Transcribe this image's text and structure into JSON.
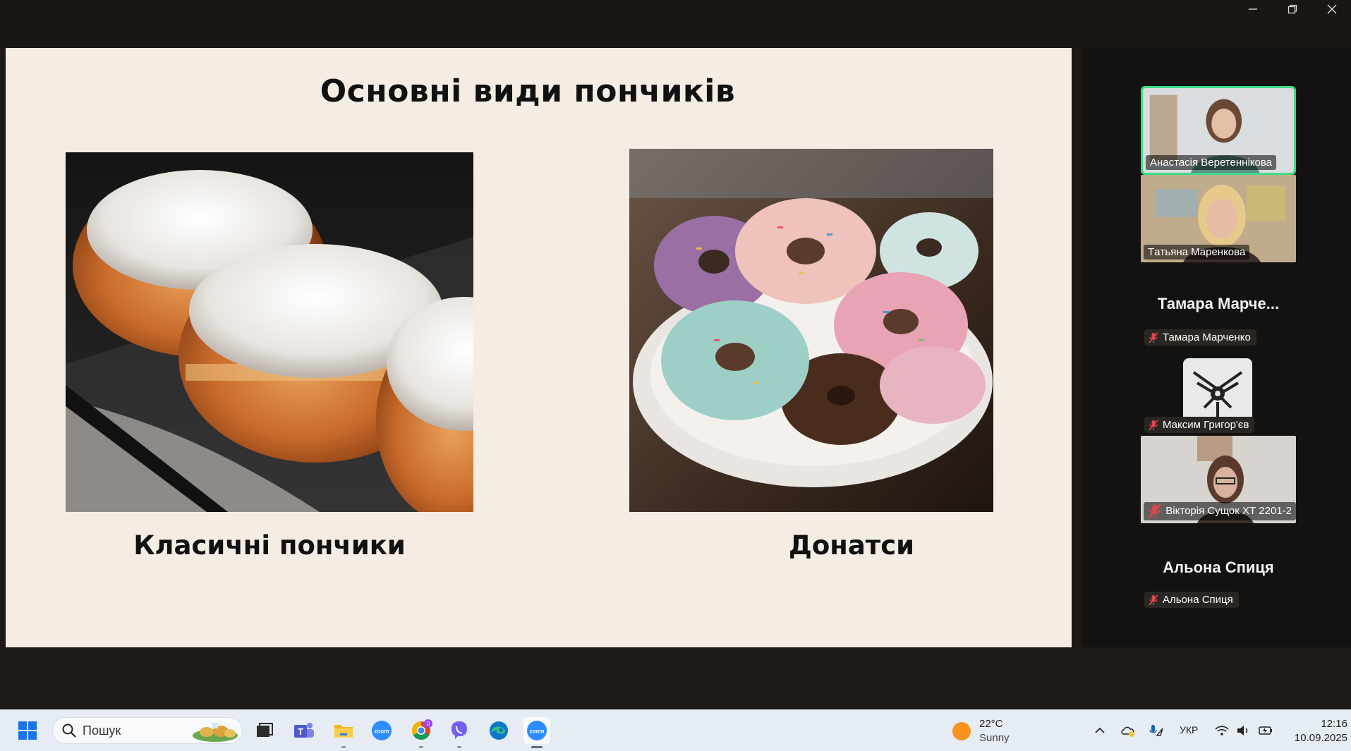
{
  "slide": {
    "title": "Основні види пончиків",
    "left_caption": "Класичні пончики",
    "right_caption": "Донатси"
  },
  "gallery": {
    "participants": [
      {
        "name": "Анастасія Веретеннікова",
        "video": true,
        "active": true
      },
      {
        "name": "Тaтьяна Маренкова",
        "video": true
      },
      {
        "display_name": "Тамара  Марче...",
        "name": "Тамара Марченко",
        "muted": true
      },
      {
        "name": "Максим Григор'єв",
        "muted": true,
        "avatar": "bird-logo-icon"
      },
      {
        "name": "Вікторія Сущок ХТ 2201-2",
        "video": true,
        "muted": true
      },
      {
        "display_name": "Альона Спиця",
        "name": "Альона Спиця",
        "muted": true
      }
    ]
  },
  "taskbar": {
    "search_placeholder": "Пошук",
    "weather_temp": "22°C",
    "weather_desc": "Sunny",
    "language": "УКР",
    "time": "12:16",
    "date": "10.09.2025",
    "chrome_badge": "0",
    "apps": [
      "windows-start-icon",
      "task-view-icon",
      "teams-icon",
      "file-explorer-icon",
      "zoom-icon",
      "chrome-icon",
      "viber-icon",
      "edge-icon",
      "zoom-active-icon"
    ]
  },
  "colors": {
    "slide_bg": "#f5ece3",
    "active_speaker": "#3ddc84",
    "taskbar_bg": "#e6ecf3"
  }
}
